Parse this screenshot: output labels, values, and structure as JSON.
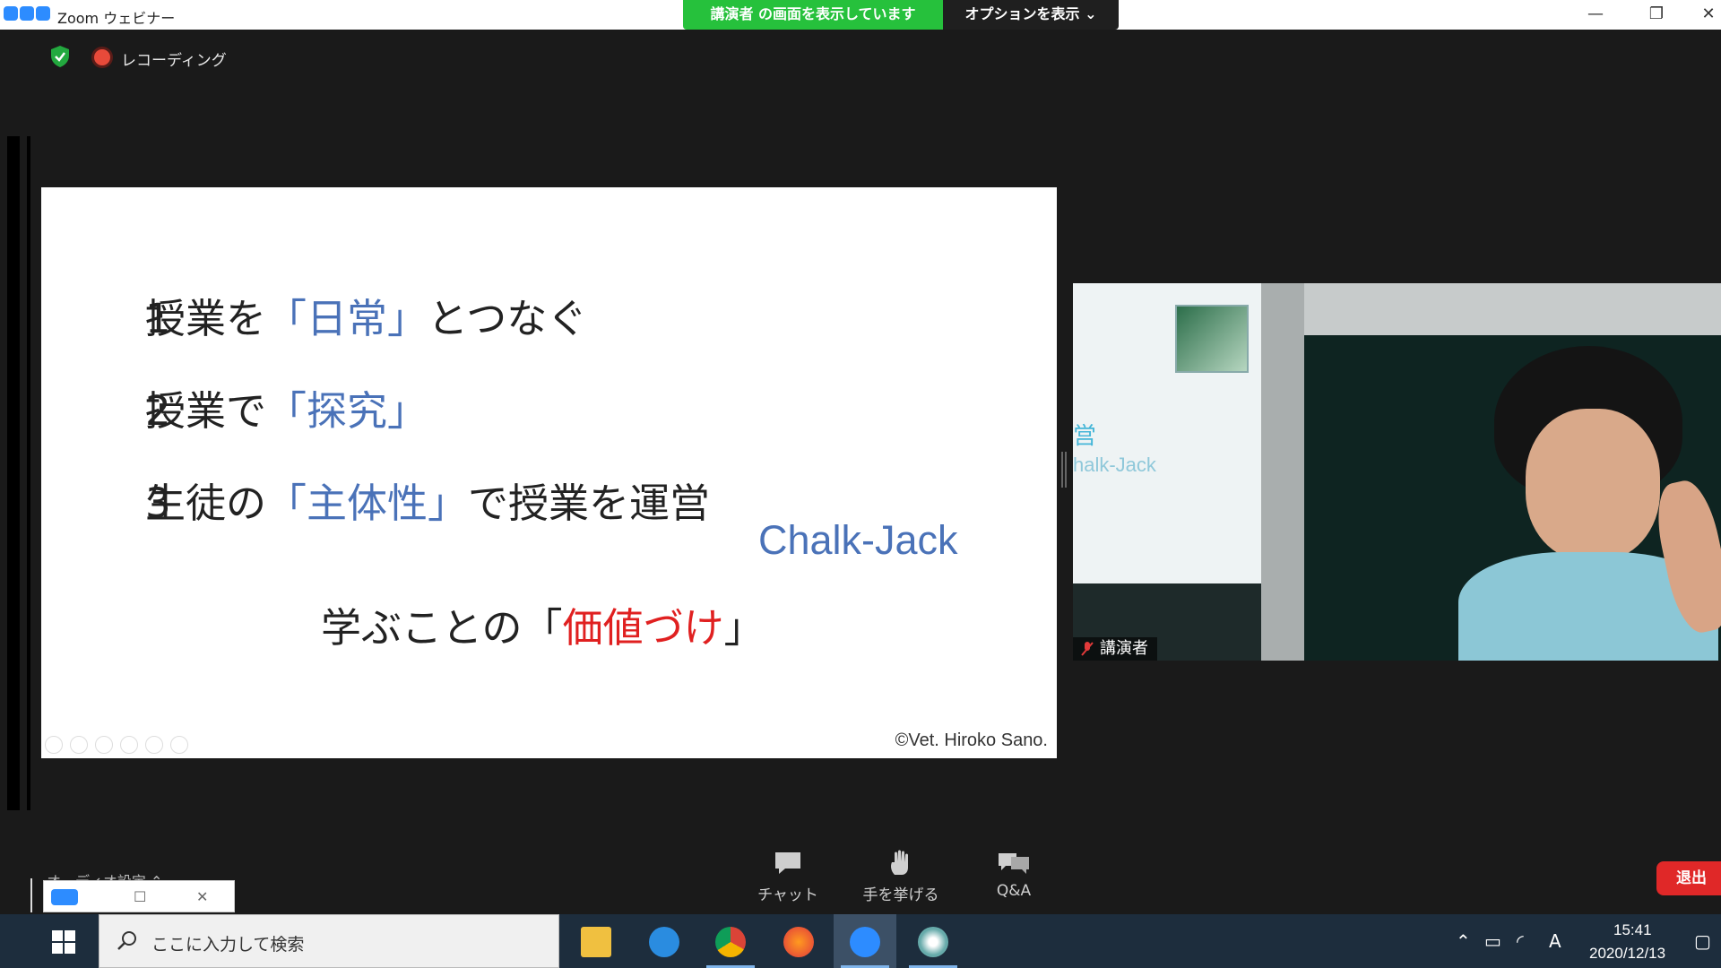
{
  "titlebar": {
    "app_title": "Zoom ウェビナー",
    "share_banner": "講演者 の画面を表示しています",
    "options_button": "オプションを表示 ⌄",
    "minimize": "—",
    "restore": "❐",
    "close": "✕"
  },
  "header": {
    "recording_label": "レコーディング"
  },
  "slide": {
    "items": [
      {
        "num": "1",
        "pre": "授業を",
        "highlight": "「日常」",
        "post": "とつなぐ"
      },
      {
        "num": "2",
        "pre": "授業で",
        "highlight": "「探究」",
        "post": ""
      },
      {
        "num": "3",
        "pre": "生徒の",
        "highlight": "「主体性」",
        "post": "で授業を運営"
      }
    ],
    "brand": "Chalk-Jack",
    "motto_pre": "学ぶことの「",
    "motto_highlight": "価値づけ",
    "motto_post": "」",
    "copyright": "©Vet. Hiroko Sano."
  },
  "video": {
    "speaker_name": "講演者",
    "screen_text_1": "営",
    "screen_text_2": "halk-Jack"
  },
  "toolbar": {
    "audio_settings": "オーディオ設定 ⌃",
    "chat_label": "チャット",
    "raise_hand_label": "手を挙げる",
    "qa_label": "Q&A",
    "leave_label": "退出"
  },
  "taskbar": {
    "search_placeholder": "ここに入力して検索",
    "time": "15:41",
    "date": "2020/12/13",
    "ime_indicator": "A"
  },
  "colors": {
    "share_green": "#26c13c",
    "slide_blue": "#4a72b8",
    "slide_red": "#e02020",
    "leave_red": "#e02828",
    "taskbar": "#1d2d3d"
  }
}
